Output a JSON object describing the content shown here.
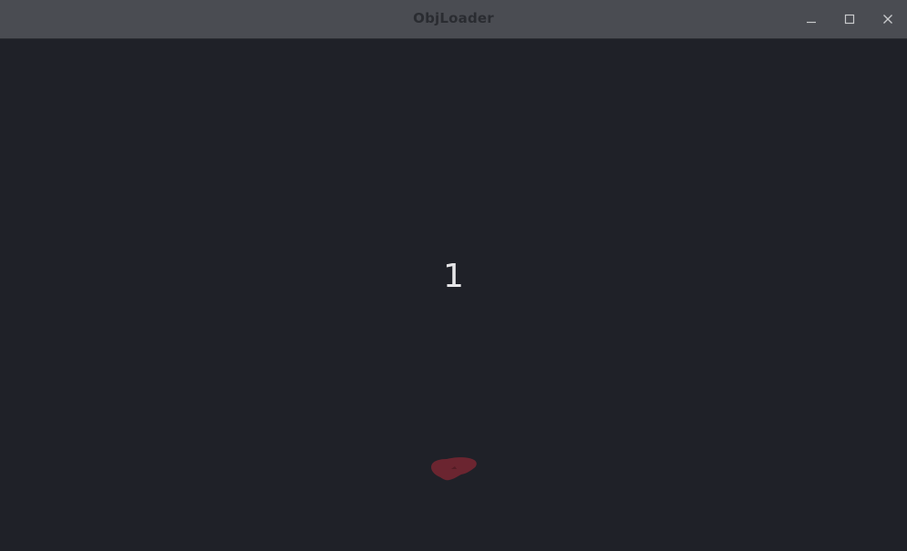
{
  "window": {
    "title": "ObjLoader",
    "controls": {
      "minimize_icon": "minimize-icon",
      "maximize_icon": "maximize-icon",
      "close_icon": "close-icon"
    }
  },
  "viewport": {
    "counter_text": "1",
    "background_color": "#1f2128",
    "model_color": "#6b2530"
  }
}
